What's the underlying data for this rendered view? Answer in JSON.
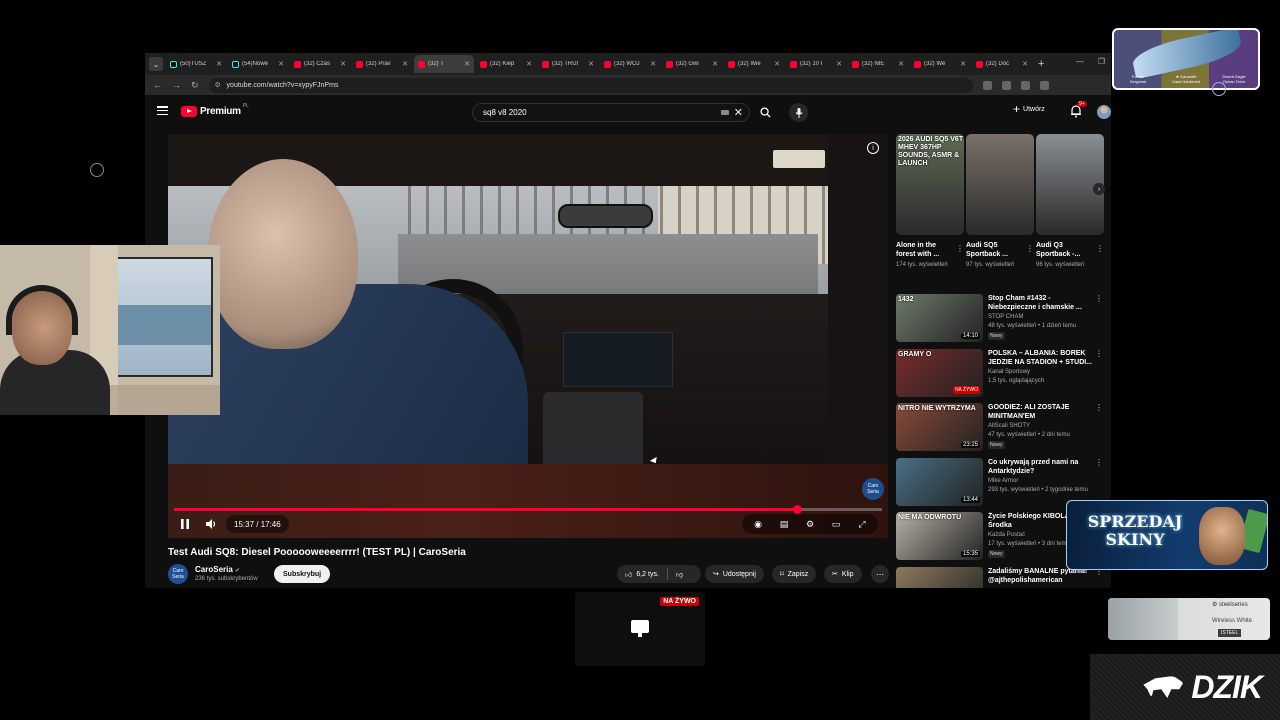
{
  "browser": {
    "tabs": [
      {
        "label": "(50)TUSZ",
        "active": false,
        "favicon": "tiktok"
      },
      {
        "label": "(54)Nowe",
        "active": false,
        "favicon": "tiktok"
      },
      {
        "label": "(32) Czas",
        "active": false,
        "favicon": "youtube"
      },
      {
        "label": "(32) Prav",
        "active": false,
        "favicon": "youtube"
      },
      {
        "label": "(32) T",
        "active": true,
        "favicon": "youtube"
      },
      {
        "label": "(32) Kiep",
        "active": false,
        "favicon": "youtube"
      },
      {
        "label": "(32) TRUI",
        "active": false,
        "favicon": "youtube"
      },
      {
        "label": "(32) WOJ",
        "active": false,
        "favicon": "youtube"
      },
      {
        "label": "(32) Gwi",
        "active": false,
        "favicon": "youtube"
      },
      {
        "label": "(32) Wie",
        "active": false,
        "favicon": "youtube"
      },
      {
        "label": "(32) 10 I",
        "active": false,
        "favicon": "youtube"
      },
      {
        "label": "(32) NIE",
        "active": false,
        "favicon": "youtube"
      },
      {
        "label": "(32) We",
        "active": false,
        "favicon": "youtube"
      },
      {
        "label": "(32) Doc",
        "active": false,
        "favicon": "youtube"
      }
    ],
    "url": "youtube.com/watch?v=xypyFJnPms"
  },
  "header": {
    "logo_text": "Premium",
    "logo_region": "PL",
    "search_value": "sq8 v8 2020",
    "create_label": "Utwórz",
    "notif_count": "9+"
  },
  "video": {
    "current_time": "15:37",
    "duration": "17:46",
    "time_display": "15:37 / 17:46",
    "progress": 0.88,
    "title": "Test Audi SQ8: Diesel Poooooweeeerrrr! (TEST PL) | CaroSeria",
    "watermark": "Caro Seria",
    "channel": {
      "name": "CaroSeria",
      "subscribers": "236 tys. subskrybentów",
      "avatar_text": "Caro Seria"
    },
    "subscribe_label": "Subskrybuj",
    "likes": "6,2 tys.",
    "share_label": "Udostępnij",
    "save_label": "Zapisz",
    "clip_label": "Klip"
  },
  "shorts": [
    {
      "title": "Alone in the forest with ...",
      "views": "174 tys. wyświetleń",
      "caption": "2026 AUDI SQ5 V6T MHEV 367HP SOUNDS, ASMR & LAUNCH",
      "color": "#5f6b55"
    },
    {
      "title": "Audi SQ5 Sportback ...",
      "views": "97 tys. wyświetleń",
      "caption": "",
      "color": "#7a7168"
    },
    {
      "title": "Audi Q3 Sportback -...",
      "views": "96 tys. wyświetleń",
      "caption": "",
      "color": "#8a8f94"
    }
  ],
  "recommendations": [
    {
      "title": "Stop Cham #1432 - Niebezpieczne i chamskie ...",
      "channel": "STOP CHAM",
      "meta": "48 tys. wyświetleń • 1 dzień temu",
      "duration": "14:10",
      "badge": "Nowy",
      "live": "",
      "color": "#6f7a6c"
    },
    {
      "title": "POLSKA – ALBANIA: BOREK JEDZIE NA STADION + STUDI...",
      "channel": "Kanał Sportowy",
      "meta": "1,5 tys. oglądających",
      "duration": "",
      "badge": "",
      "live": "NA ŻYWO",
      "color": "#7a2b2b"
    },
    {
      "title": "GOODIEZ: ALI ZOSTAJE MINITMAN'EM",
      "channel": "AllScali SHOTY",
      "meta": "47 tys. wyświetleń • 2 dni temu",
      "duration": "23:25",
      "badge": "Nowy",
      "live": "",
      "color": "#8a4a3a"
    },
    {
      "title": "Co ukrywają przed nami na Antarktydzie?",
      "channel": "Mike Armor",
      "meta": "293 tys. wyświetleń • 2 tygodnie temu",
      "duration": "13:44",
      "badge": "",
      "live": "",
      "color": "#4a6f86"
    },
    {
      "title": "Życie Polskiego KIBOLA Środka",
      "channel": "Każda Postać",
      "meta": "17 tys. wyświetleń • 3 dni temu",
      "duration": "15:35",
      "badge": "Nowy",
      "live": "",
      "color": "#b8b2a6"
    },
    {
      "title": "Zadaliśmy BANALNE pytania! @ajthepolishamerican",
      "channel": "",
      "meta": "",
      "duration": "",
      "badge": "",
      "live": "",
      "color": "#8c7a5e"
    }
  ],
  "thumb_captions": {
    "stop_cham": "1432",
    "gramy": "GRAMY O",
    "nitro": "NITRO NIE WYTRZYMA",
    "nie_ma": "NIE MA ODWROTU"
  },
  "overlays": {
    "banner_text": "SPRZEDAJ SKINY",
    "live_badge": "NA ŻYWO",
    "steel_brand": "steelseries",
    "steel_model": "Wireless White",
    "steel_shop": "ISTEEL",
    "dzik_word": "DZIK",
    "skins": [
      {
        "name": "Fornax",
        "sub": "Sergeant"
      },
      {
        "name": "★ Karambit",
        "sub": "Case Hardened"
      },
      {
        "name": "Desert Eagle",
        "sub": "Ocean Drive"
      }
    ]
  }
}
